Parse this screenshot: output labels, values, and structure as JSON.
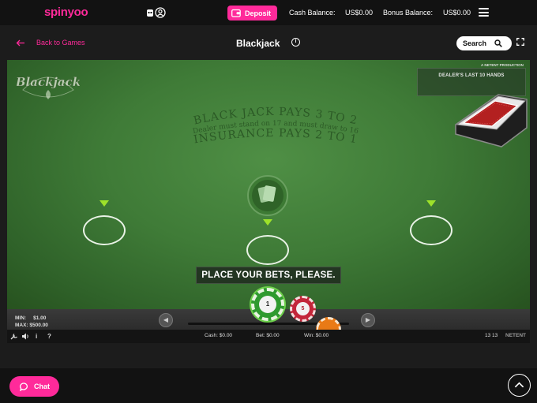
{
  "header": {
    "logo_text": "spinyoo",
    "deposit_label": "Deposit",
    "cash_balance_label": "Cash Balance:",
    "cash_balance_value": "US$0.00",
    "bonus_balance_label": "Bonus Balance:",
    "bonus_balance_value": "US$0.00",
    "icons": [
      "robot-icon",
      "user-icon",
      "wallet-icon",
      "menu-icon"
    ]
  },
  "subheader": {
    "back_label": "Back to Games",
    "game_title": "Blackjack",
    "search_label": "Search",
    "icons": [
      "arrow-left-icon",
      "info-icon",
      "search-icon",
      "fullscreen-icon"
    ]
  },
  "game": {
    "logo_text": "Blackjack",
    "history_title": "DEALER'S LAST 10 HANDS",
    "producer": "A NETENT PRODUCTION",
    "arc_line1": "BLACK JACK PAYS 3 TO 2",
    "arc_line2": "Dealer must stand on 17 and must draw to 16",
    "arc_line3": "INSURANCE PAYS 2 TO 1",
    "prompt": "PLACE YOUR BETS, PLEASE.",
    "min_label": "MIN:",
    "min_value": "$1.00",
    "max_label": "MAX:",
    "max_value": "$500.00",
    "chips": [
      "1",
      "5"
    ],
    "status": {
      "cash": "Cash: $0.00",
      "bet": "Bet: $0.00",
      "win": "Win: $0.00",
      "time": "13 13",
      "brand": "NETENT"
    }
  },
  "footer": {
    "chat_label": "Chat"
  },
  "colors": {
    "brand_pink": "#ff2a9a",
    "felt_green": "#3f7b37",
    "arrow_green": "#9ee22a"
  }
}
